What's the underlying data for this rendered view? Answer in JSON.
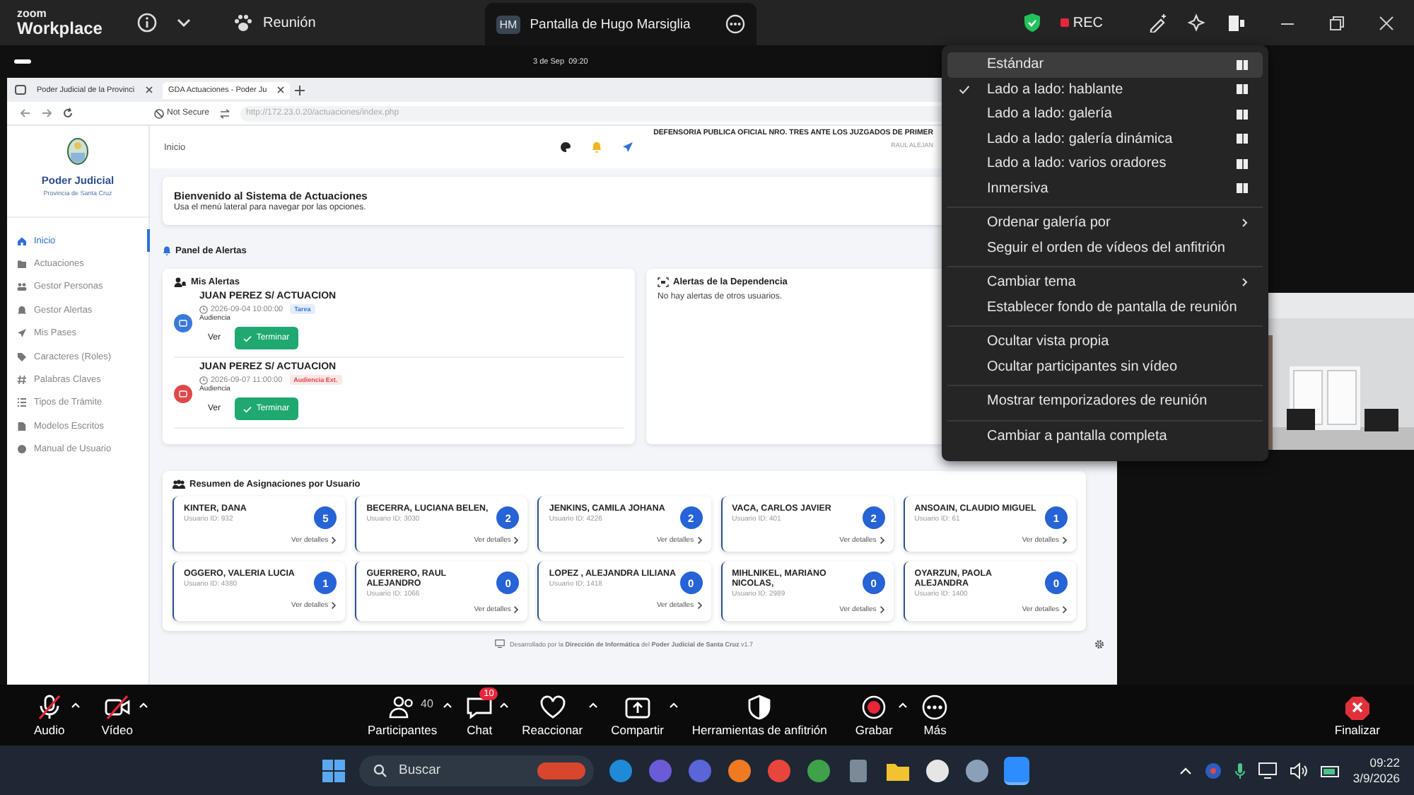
{
  "app": {
    "logo_top": "zoom",
    "logo_bottom": "Workplace",
    "meeting": "Reunión",
    "share_tab": {
      "initials": "HM",
      "title": "Pantalla de Hugo Marsiglia"
    },
    "rec": "REC"
  },
  "share_bar": {
    "time": "3 de Sep  09:20"
  },
  "browser": {
    "tabs": [
      {
        "title": "Poder Judicial de la Provinci",
        "selected": false
      },
      {
        "title": "GDA Actuaciones - Poder Ju",
        "selected": true
      }
    ],
    "security": "Not Secure",
    "url": "http://172.23.0.20/actuaciones/index.php"
  },
  "site": {
    "brand": "Poder Judicial",
    "province": "Provincia de Santa Cruz",
    "nav": [
      {
        "label": "Inicio",
        "selected": true
      },
      {
        "label": "Actuaciones",
        "selected": false
      },
      {
        "label": "Gestor Personas",
        "selected": false
      },
      {
        "label": "Gestor Alertas",
        "selected": false
      },
      {
        "label": "Mis Pases",
        "selected": false
      },
      {
        "label": "Caracteres (Roles)",
        "selected": false
      },
      {
        "label": "Palabras Claves",
        "selected": false
      },
      {
        "label": "Tipos de Trámite",
        "selected": false
      },
      {
        "label": "Modelos Escritos",
        "selected": false
      },
      {
        "label": "Manual de Usuario",
        "selected": false
      }
    ],
    "breadcrumb": "Inicio",
    "office": "DEFENSORIA PUBLICA OFICIAL NRO. TRES ANTE LOS JUZGADOS DE PRIMER",
    "user": "RAUL ALEJAN",
    "welcome": {
      "title": "Bienvenido al Sistema de Actuaciones",
      "subtitle": "Usa el menú lateral para navegar por las opciones."
    },
    "alerts_heading": "Panel de Alertas",
    "my_alerts": {
      "title": "Mis Alertas",
      "items": [
        {
          "title": "JUAN PEREZ S/ ACTUACION",
          "datetime": "2026-09-04 10:00:00",
          "tag": "Tarea",
          "color": "#3a78db",
          "type": "Audiencia",
          "view": "Ver",
          "done": "Terminar"
        },
        {
          "title": "JUAN PEREZ S/ ACTUACION",
          "datetime": "2026-09-07 11:00:00",
          "tag": "Audiencia Ext.",
          "color": "#e04848",
          "type": "Audiencia",
          "view": "Ver",
          "done": "Terminar"
        }
      ]
    },
    "dept_alerts": {
      "title": "Alertas de la Dependencia",
      "empty": "No hay alertas de otros usuarios."
    },
    "summary": {
      "title": "Resumen de Asignaciones por Usuario",
      "users": [
        {
          "name": "KINTER, DANA",
          "id": "Usuario ID: 932",
          "count": "5",
          "link": "Ver detalles"
        },
        {
          "name": "BECERRA, LUCIANA BELEN,",
          "id": "Usuario ID: 3030",
          "count": "2",
          "link": "Ver detalles"
        },
        {
          "name": "JENKINS, CAMILA JOHANA",
          "id": "Usuario ID: 4226",
          "count": "2",
          "link": "Ver detalles"
        },
        {
          "name": "VACA, CARLOS JAVIER",
          "id": "Usuario ID: 401",
          "count": "2",
          "link": "Ver detalles"
        },
        {
          "name": "ANSOAIN, CLAUDIO MIGUEL",
          "id": "Usuario ID: 61",
          "count": "1",
          "link": "Ver detalles"
        },
        {
          "name": "OGGERO, VALERIA LUCIA",
          "id": "Usuario ID: 4380",
          "count": "1",
          "link": "Ver detalles"
        },
        {
          "name": "GUERRERO, RAUL ALEJANDRO",
          "id": "Usuario ID: 1066",
          "count": "0",
          "link": "Ver detalles"
        },
        {
          "name": "LOPEZ , ALEJANDRA LILIANA",
          "id": "Usuario ID: 1418",
          "count": "0",
          "link": "Ver detalles"
        },
        {
          "name": "MIHLNIKEL, MARIANO NICOLAS,",
          "id": "Usuario ID: 2989",
          "count": "0",
          "link": "Ver detalles"
        },
        {
          "name": "OYARZUN, PAOLA ALEJANDRA",
          "id": "Usuario ID: 1400",
          "count": "0",
          "link": "Ver detalles"
        }
      ]
    },
    "footer": "Desarrollado por la **Dirección de Informática** del **Poder Judicial de Santa Cruz** v1.7"
  },
  "menu": {
    "groups": [
      [
        {
          "label": "Estándar",
          "kind": "layout",
          "checked": false,
          "selected": true
        },
        {
          "label": "Lado a lado: hablante",
          "kind": "layout",
          "checked": true,
          "selected": false
        },
        {
          "label": "Lado a lado: galería",
          "kind": "layout",
          "checked": false,
          "selected": false
        },
        {
          "label": "Lado a lado: galería dinámica",
          "kind": "layout",
          "checked": false,
          "selected": false
        },
        {
          "label": "Lado a lado: varios oradores",
          "kind": "layout",
          "checked": false,
          "selected": false
        },
        {
          "label": "Inmersiva",
          "kind": "layout",
          "checked": false,
          "selected": false
        }
      ],
      [
        {
          "label": "Ordenar galería por",
          "kind": "submenu",
          "checked": false,
          "selected": false
        },
        {
          "label": "Seguir el orden de vídeos del anfitrión",
          "kind": "plain",
          "checked": false,
          "selected": false
        }
      ],
      [
        {
          "label": "Cambiar tema",
          "kind": "submenu",
          "checked": false,
          "selected": false
        },
        {
          "label": "Establecer fondo de pantalla de reunión",
          "kind": "plain",
          "checked": false,
          "selected": false
        }
      ],
      [
        {
          "label": "Ocultar vista propia",
          "kind": "plain",
          "checked": false,
          "selected": false
        },
        {
          "label": "Ocultar participantes sin vídeo",
          "kind": "plain",
          "checked": false,
          "selected": false
        }
      ],
      [
        {
          "label": "Mostrar temporizadores de reunión",
          "kind": "plain",
          "checked": false,
          "selected": false
        }
      ],
      [
        {
          "label": "Cambiar a pantalla completa",
          "kind": "plain",
          "checked": false,
          "selected": false
        }
      ]
    ]
  },
  "toolbar": {
    "left": [
      {
        "label": "Audio",
        "kind": "mic",
        "off": true
      },
      {
        "label": "Vídeo",
        "kind": "video",
        "off": true
      }
    ],
    "center": [
      {
        "label": "Participantes",
        "kind": "people",
        "off": false,
        "count": "40"
      },
      {
        "label": "Chat",
        "kind": "chat",
        "off": false,
        "badge": "10"
      },
      {
        "label": "Reaccionar",
        "kind": "heart",
        "off": false
      },
      {
        "label": "Compartir",
        "kind": "share",
        "off": false
      },
      {
        "label": "Herramientas de anfitrión",
        "kind": "shield",
        "off": false
      },
      {
        "label": "Grabar",
        "kind": "record",
        "off": false
      },
      {
        "label": "Más",
        "kind": "more",
        "off": false
      }
    ],
    "right": [
      {
        "label": "Finalizar",
        "kind": "end",
        "off": false
      }
    ]
  },
  "taskbar": {
    "search": "Buscar",
    "time": "09:22",
    "date": "3/9/2026"
  }
}
